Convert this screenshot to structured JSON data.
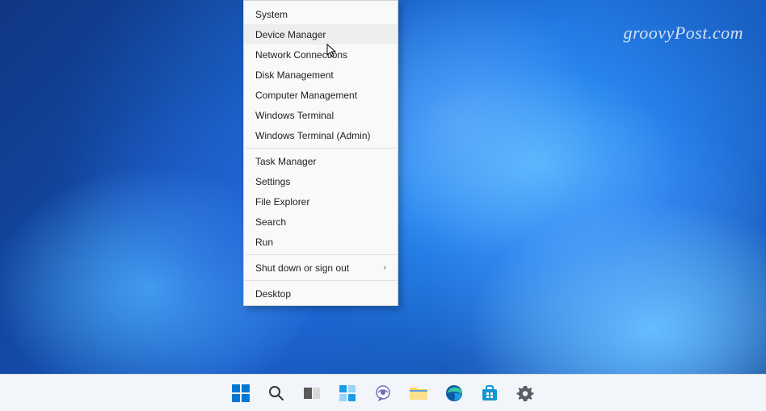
{
  "watermark": "groovyPost.com",
  "menu": {
    "groups": [
      [
        "System",
        "Device Manager",
        "Network Connections",
        "Disk Management",
        "Computer Management",
        "Windows Terminal",
        "Windows Terminal (Admin)"
      ],
      [
        "Task Manager",
        "Settings",
        "File Explorer",
        "Search",
        "Run"
      ],
      [
        "Shut down or sign out"
      ],
      [
        "Desktop"
      ]
    ],
    "submenu_items": [
      "Shut down or sign out"
    ],
    "hovered": "Device Manager"
  },
  "taskbar": {
    "items": [
      {
        "name": "start",
        "label": "Start"
      },
      {
        "name": "search",
        "label": "Search"
      },
      {
        "name": "task-view",
        "label": "Task View"
      },
      {
        "name": "widgets",
        "label": "Widgets"
      },
      {
        "name": "chat",
        "label": "Chat"
      },
      {
        "name": "file-explorer",
        "label": "File Explorer"
      },
      {
        "name": "edge",
        "label": "Microsoft Edge"
      },
      {
        "name": "store",
        "label": "Microsoft Store"
      },
      {
        "name": "settings",
        "label": "Settings"
      }
    ]
  }
}
